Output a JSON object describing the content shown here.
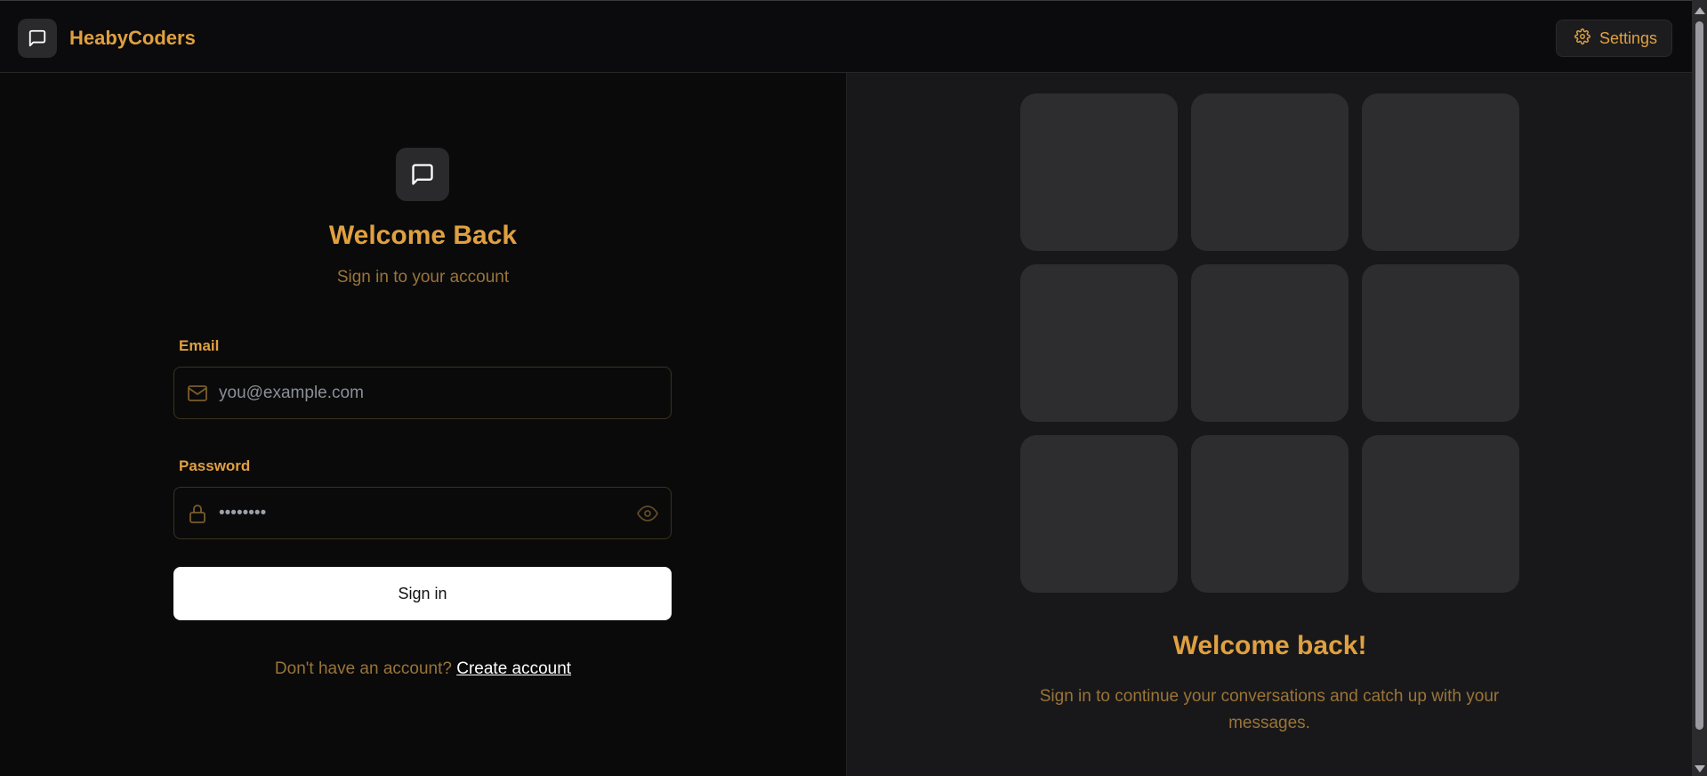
{
  "header": {
    "brand_name": "HeabyCoders",
    "brand_icon": "message-square-icon",
    "settings_label": "Settings",
    "settings_icon": "gear-icon"
  },
  "login": {
    "logo_icon": "message-square-icon",
    "title": "Welcome Back",
    "subtitle": "Sign in to your account",
    "email": {
      "label": "Email",
      "placeholder": "you@example.com",
      "value": "",
      "icon": "mail-icon"
    },
    "password": {
      "label": "Password",
      "value": "••••••••",
      "icon": "lock-icon",
      "toggle_icon": "eye-icon"
    },
    "signin_label": "Sign in",
    "signup_prompt": "Don't have an account?",
    "signup_link": "Create account"
  },
  "promo": {
    "title": "Welcome back!",
    "text": "Sign in to continue your conversations and catch up with your messages."
  },
  "colors": {
    "accent": "#e0a040",
    "muted_accent": "#9a7438",
    "background": "#0a0a0b",
    "panel": "#18181a",
    "tile": "#2d2d30"
  }
}
